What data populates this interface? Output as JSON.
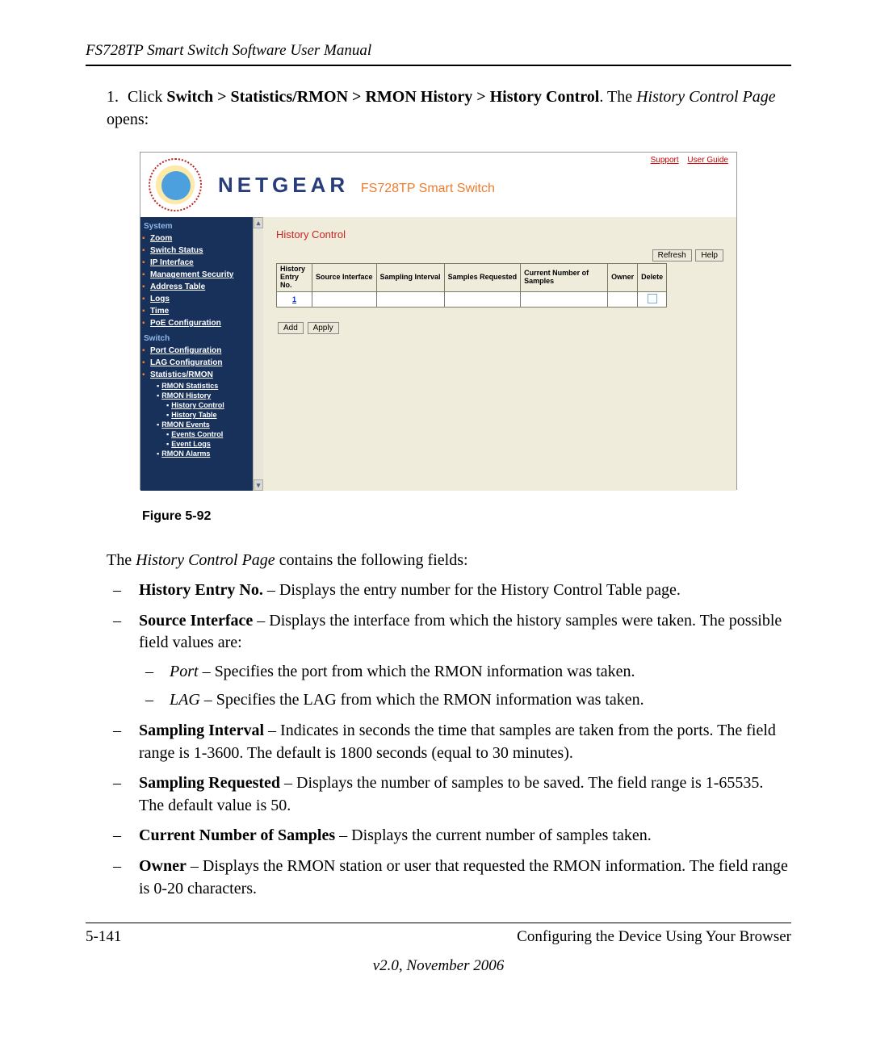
{
  "page": {
    "header_title": "FS728TP Smart Switch Software User Manual",
    "instruction_num": "1.",
    "instruction_pre": "Click ",
    "instruction_path": "Switch > Statistics/RMON > RMON History > History Control",
    "instruction_mid": ". The ",
    "instruction_em": "History Control Page",
    "instruction_post": " opens:",
    "figure_label": "Figure 5-92",
    "intro_text_pre": "The ",
    "intro_text_em": "History Control Page",
    "intro_text_post": " contains the following fields:",
    "footer_left": "5-141",
    "footer_right": "Configuring the Device Using Your Browser",
    "footer_center": "v2.0, November 2006"
  },
  "screenshot": {
    "brand": "NETGEAR",
    "brand_sub": "FS728TP Smart Switch",
    "support_link": "Support",
    "userguide_link": "User Guide",
    "nav": {
      "section_system": "System",
      "zoom": "Zoom",
      "switch_status": "Switch Status",
      "ip_interface": "IP Interface",
      "mgmt_security": "Management Security",
      "address_table": "Address Table",
      "logs": "Logs",
      "time": "Time",
      "poe": "PoE Configuration",
      "section_switch": "Switch",
      "port_config": "Port Configuration",
      "lag_config": "LAG Configuration",
      "stats_rmon": "Statistics/RMON",
      "rmon_stats": "RMON Statistics",
      "rmon_history": "RMON History",
      "history_control": "History Control",
      "history_table": "History Table",
      "rmon_events": "RMON Events",
      "events_control": "Events Control",
      "event_logs": "Event Logs",
      "rmon_alarms": "RMON Alarms"
    },
    "content": {
      "title": "History Control",
      "btn_refresh": "Refresh",
      "btn_help": "Help",
      "th_entry": "History Entry No.",
      "th_source": "Source Interface",
      "th_sampint": "Sampling Interval",
      "th_sampreq": "Samples Requested",
      "th_curnum": "Current Number of Samples",
      "th_owner": "Owner",
      "th_delete": "Delete",
      "row1_entry": "1",
      "btn_add": "Add",
      "btn_apply": "Apply"
    }
  },
  "fields": {
    "f1_label": "History Entry No.",
    "f1_text": " – Displays the entry number for the History Control Table page.",
    "f2_label": "Source Interface",
    "f2_text": " – Displays the interface from which the history samples were taken. The possible field values are:",
    "f2a_em": "Port",
    "f2a_text": " – Specifies the port from which the RMON information was taken.",
    "f2b_em": "LAG",
    "f2b_text": " – Specifies the LAG from which the RMON information was taken.",
    "f3_label": "Sampling Interval",
    "f3_text": " – Indicates in seconds the time that samples are taken from the ports. The field range is 1-3600. The default is 1800 seconds (equal to 30 minutes).",
    "f4_label": "Sampling Requested",
    "f4_text": " – Displays the number of samples to be saved. The field range is 1-65535. The default value is 50.",
    "f5_label": "Current Number of Samples",
    "f5_text": " – Displays the current number of samples taken.",
    "f6_label": "Owner",
    "f6_text": " – Displays the RMON station or user that requested the RMON information. The field range is 0-20 characters."
  }
}
